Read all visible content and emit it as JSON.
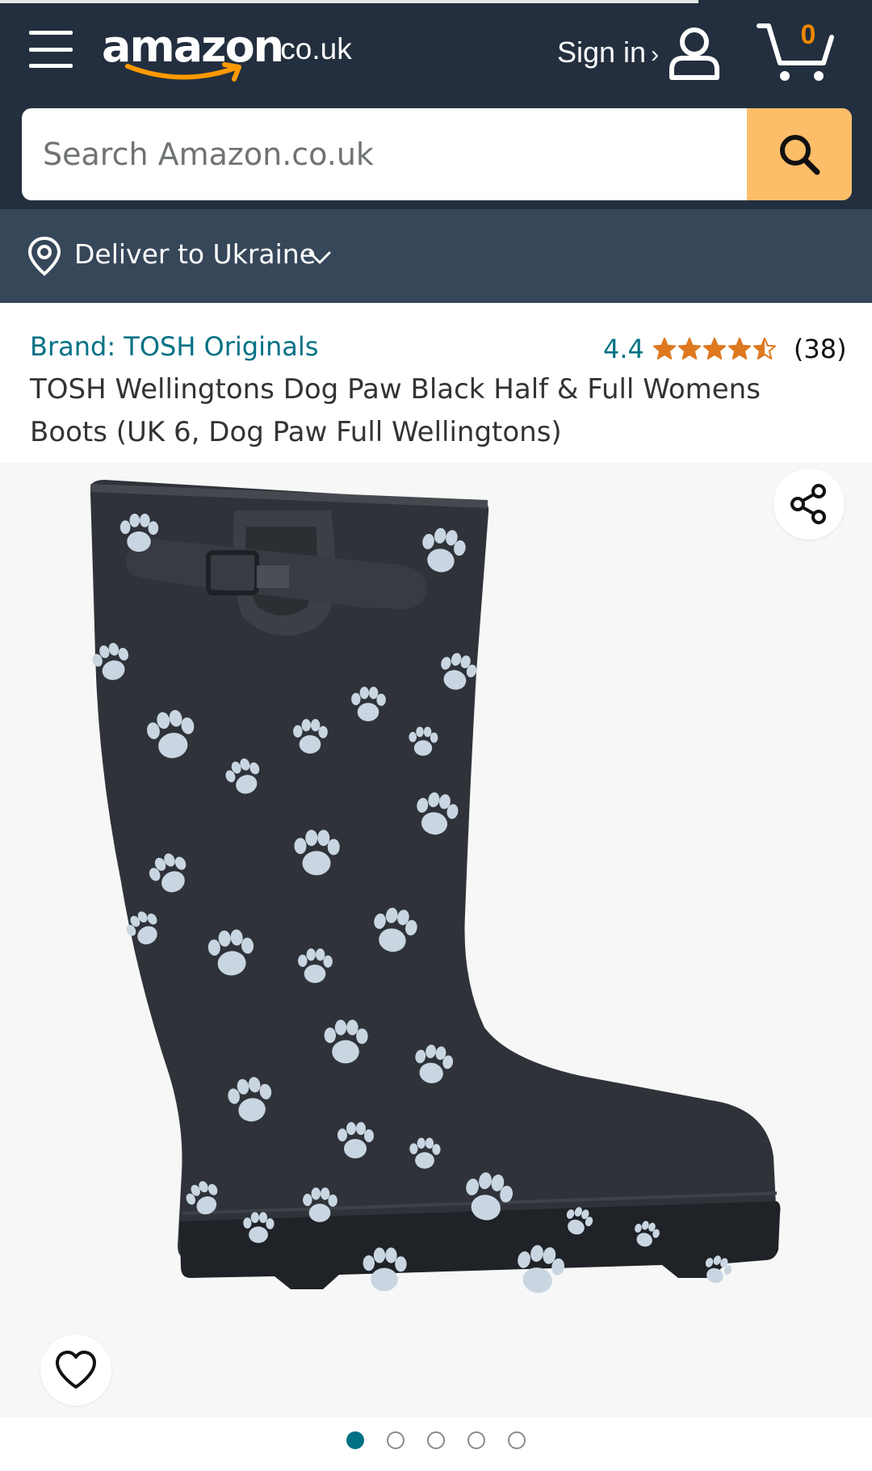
{
  "header": {
    "logo_word": "amazon",
    "logo_tld": ".co.uk",
    "signin_label": "Sign in",
    "signin_chevron": "›",
    "cart_count": "0",
    "icons": [
      "menu-icon",
      "user-icon",
      "cart-icon",
      "search-icon"
    ]
  },
  "search": {
    "placeholder": "Search Amazon.co.uk",
    "value": ""
  },
  "delivery": {
    "label": "Deliver to Ukraine",
    "icons": [
      "location-pin-icon",
      "chevron-down-icon"
    ]
  },
  "product": {
    "brand": "Brand: TOSH Originals",
    "rating_value": "4.4",
    "rating_stars": 4.5,
    "rating_count": "(38)",
    "title": "TOSH Wellingtons Dog Paw Black Half & Full Womens Boots (UK 6, Dog Paw Full Wellingtons)"
  },
  "gallery": {
    "image_count": 5,
    "active_index": 0,
    "icons": [
      "share-icon",
      "heart-icon"
    ]
  },
  "colors": {
    "header_bg": "#232f3e",
    "subheader_bg": "#37475a",
    "search_button": "#febd69",
    "link": "#007185",
    "star": "#de7921",
    "cart_count": "#f08804",
    "boot": "#2f3339",
    "paw": "#c9d6e2"
  }
}
